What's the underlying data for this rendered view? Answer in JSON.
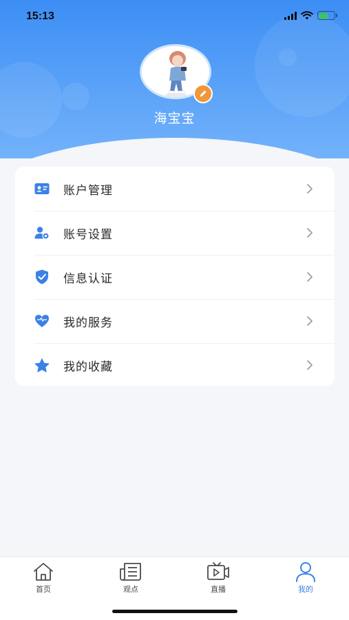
{
  "status_bar": {
    "time": "15:13"
  },
  "profile": {
    "username": "海宝宝"
  },
  "menu": {
    "items": [
      {
        "label": "账户管理",
        "icon": "id-card-icon"
      },
      {
        "label": "账号设置",
        "icon": "user-gear-icon"
      },
      {
        "label": "信息认证",
        "icon": "shield-check-icon"
      },
      {
        "label": "我的服务",
        "icon": "heart-icon"
      },
      {
        "label": "我的收藏",
        "icon": "star-icon"
      }
    ]
  },
  "tabbar": {
    "tabs": [
      {
        "label": "首页",
        "icon": "home-icon"
      },
      {
        "label": "观点",
        "icon": "newspaper-icon"
      },
      {
        "label": "直播",
        "icon": "live-tv-icon"
      },
      {
        "label": "我的",
        "icon": "user-icon",
        "active": true
      }
    ]
  },
  "colors": {
    "accent": "#3b82e6",
    "header_gradient_top": "#3c8ef5",
    "edit_badge": "#f0973a",
    "battery_fill": "#38c759"
  }
}
